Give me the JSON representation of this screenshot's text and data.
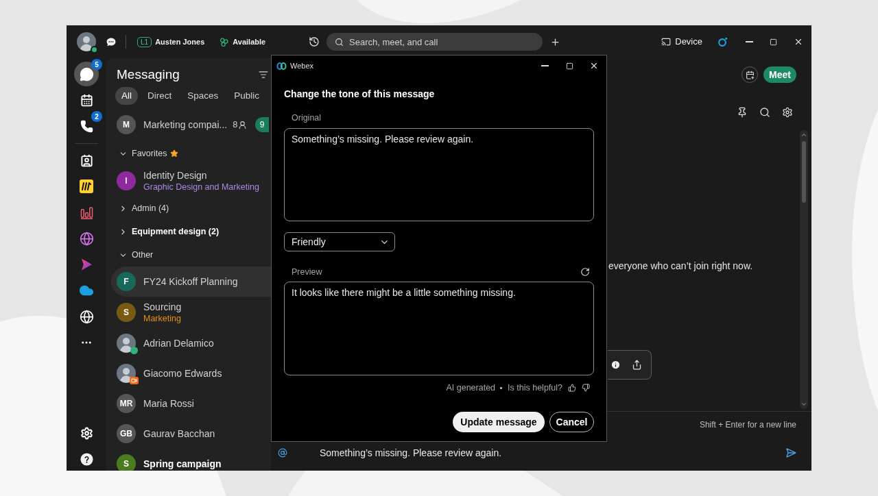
{
  "top_bar": {
    "available": true,
    "line_badge": "L1",
    "user_name": "Austen Jones",
    "status": "Available",
    "search": {
      "placeholder": "Search, meet, and call"
    },
    "device_label": "Device"
  },
  "rail": {
    "items": [
      {
        "selected": true,
        "badge": "5"
      },
      {
        "selected": false
      },
      {
        "selected": false,
        "badge": "2"
      },
      {
        "selected": false
      },
      {
        "selected": false
      },
      {
        "selected": false
      },
      {
        "selected": false
      },
      {
        "selected": false
      },
      {
        "selected": false
      },
      {
        "selected": false
      },
      {
        "selected": false
      }
    ]
  },
  "messaging": {
    "title": "Messaging",
    "filters": [
      {
        "label": "All",
        "selected": true
      },
      {
        "label": "Direct",
        "selected": false
      },
      {
        "label": "Spaces",
        "selected": false
      },
      {
        "label": "Public",
        "selected": false
      }
    ],
    "pinned": {
      "name": "Marketing compai...",
      "avatar": {
        "kind": "initials",
        "text": "M",
        "color": "#555555"
      },
      "member_count": "8",
      "unread_count": "9"
    },
    "sections": [
      {
        "label": "Favorites",
        "expanded": true,
        "starred": true,
        "unread": false,
        "items": [
          {
            "name": "Identity Design",
            "avatar": {
              "kind": "initials",
              "text": "I",
              "color": "#8e2a9e"
            },
            "subtitle": {
              "text": "Graphic Design and Marketing",
              "color": "#ad8ae6"
            },
            "selected": false,
            "unread": false
          }
        ]
      },
      {
        "label": "Admin (4)",
        "expanded": false,
        "starred": false,
        "unread": false
      },
      {
        "label": "Equipment design (2)",
        "expanded": false,
        "starred": false,
        "unread": true
      },
      {
        "label": "Other",
        "expanded": true,
        "starred": false,
        "unread": false,
        "items": [
          {
            "name": "FY24 Kickoff Planning",
            "avatar": {
              "kind": "initials",
              "text": "F",
              "color": "#17695c"
            },
            "selected": true,
            "unread": false
          },
          {
            "name": "Sourcing",
            "avatar": {
              "kind": "initials",
              "text": "S",
              "color": "#7a5a12"
            },
            "subtitle": {
              "text": "Marketing",
              "color": "#e8900f"
            },
            "selected": false,
            "unread": false
          },
          {
            "name": "Adrian Delamico",
            "avatar": {
              "kind": "photo",
              "online": true,
              "in_meeting": false
            },
            "selected": false,
            "unread": false
          },
          {
            "name": "Giacomo Edwards",
            "avatar": {
              "kind": "photo",
              "online": false,
              "in_meeting": true
            },
            "selected": false,
            "unread": false
          },
          {
            "name": "Maria Rossi",
            "avatar": {
              "kind": "initials",
              "text": "MR",
              "color": "#565656"
            },
            "selected": false,
            "unread": false
          },
          {
            "name": "Gaurav Bacchan",
            "avatar": {
              "kind": "initials",
              "text": "GB",
              "color": "#565656"
            },
            "selected": false,
            "unread": false
          },
          {
            "name": "Spring campaign",
            "avatar": {
              "kind": "initials",
              "text": "S",
              "color": "#4a7c1f"
            },
            "selected": false,
            "unread": true
          }
        ]
      }
    ]
  },
  "conversation": {
    "meet_label": "Meet",
    "message_tail": "everyone who can’t join right now.",
    "composer": {
      "hint": "Shift + Enter for a new line",
      "value": "Something’s missing. Please review again."
    }
  },
  "dialog": {
    "app_name": "Webex",
    "title": "Change the tone of this message",
    "original": {
      "label": "Original",
      "value": "Something’s missing. Please review again."
    },
    "tone": {
      "value": "Friendly"
    },
    "preview": {
      "label": "Preview",
      "value": "It looks like there might be a little something missing."
    },
    "ai_note": "AI generated",
    "feedback_prompt": "Is this helpful?",
    "buttons": [
      {
        "kind": "primary",
        "label": "Update message"
      },
      {
        "kind": "secondary",
        "label": "Cancel"
      }
    ]
  }
}
